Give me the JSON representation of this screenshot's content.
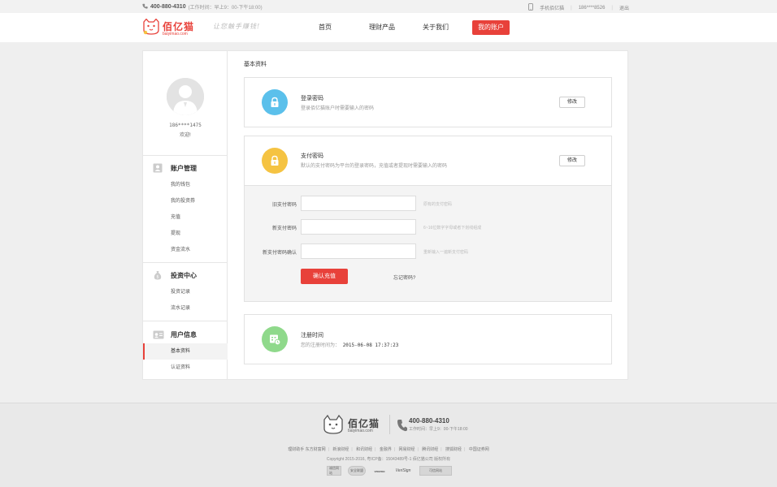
{
  "topbar": {
    "hotline": "400-880-4310",
    "hours": "(工作时间：早上9：00-下午18:00)",
    "mobile_label": "手机佰亿猫",
    "phone_masked": "186****8526",
    "logout": "退出"
  },
  "header": {
    "brand": "佰亿猫",
    "domain": "baiyimao.com",
    "slogan": "让您触手赚钱!",
    "nav": [
      "首页",
      "理财产品",
      "关于我们",
      "我的账户"
    ],
    "active_nav": "我的账户"
  },
  "sidebar": {
    "username": "186****1475",
    "welcome": "欢迎!",
    "sections": [
      {
        "title": "账户管理",
        "items": [
          "我的钱包",
          "我的投资券",
          "充值",
          "提现",
          "资金流水"
        ]
      },
      {
        "title": "投资中心",
        "items": [
          "投资记录",
          "流水记录"
        ]
      },
      {
        "title": "用户信息",
        "items": [
          "基本资料",
          "认证资料"
        ]
      }
    ],
    "active_item": "基本资料"
  },
  "content": {
    "title": "基本资料",
    "login_pw": {
      "title": "登录密码",
      "desc": "登录佰亿猫账户时需要输入的密码",
      "button": "修改"
    },
    "pay_pw": {
      "title": "支付密码",
      "desc": "默认的支付密码为平台的登录密码，充值或者提现时需要输入的密码",
      "button": "修改"
    },
    "form": {
      "rows": [
        {
          "label": "旧支付密码",
          "hint": "原有的支付密码"
        },
        {
          "label": "新支付密码",
          "hint": "6~16位数字字母或者下划线组成"
        },
        {
          "label": "新支付密码确认",
          "hint": "重新输入一遍新支付密码"
        }
      ],
      "submit": "确认充值",
      "forgot": "忘记密码?"
    },
    "register": {
      "title": "注册时间",
      "label": "您的注册时间为：",
      "value": "2015-06-08 17:37:23"
    }
  },
  "footer": {
    "brand": "佰亿猫",
    "domain": "baiyimao.com",
    "hotline": "400-880-4310",
    "hours": "工作时间：早上9：00-下午18:00",
    "links": [
      "理财助手 东方财富网",
      "新浪财经",
      "和讯财经",
      "金融界",
      "网易财经",
      "腾讯财经",
      "搜狐财经",
      "中国证券网"
    ],
    "copyright": "Copyright 2015-2016,  粤ICP备：15043489号-1  佰亿猫公司 版权所有",
    "badges": [
      "诚信网站",
      "安全联盟",
      "vnomo",
      "VeriSign",
      "可信网站"
    ]
  },
  "colors": {
    "accent": "#e8413a",
    "lock_blue": "#5bc0eb",
    "lock_yellow": "#f5c342",
    "register_green": "#8fd98b"
  }
}
